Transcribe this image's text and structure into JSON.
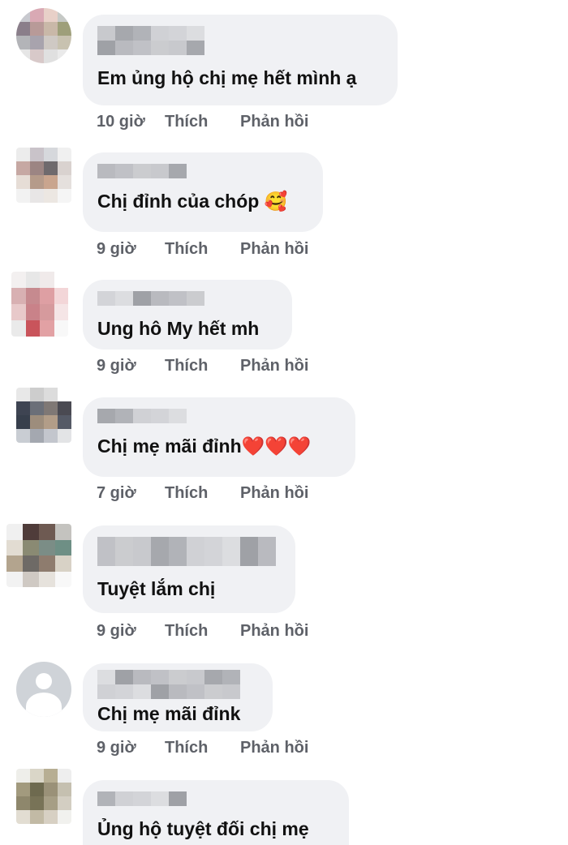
{
  "comments": [
    {
      "text": "Em ủng hộ chị mẹ hết mình ạ",
      "time": "10 giờ",
      "like": "Thích",
      "reply": "Phản hồi",
      "avatar_colors": [
        "#c8c9cf",
        "#d9a9b4",
        "#e8d0c8",
        "#c6c9c6",
        "#8a7e8a",
        "#b89a98",
        "#c9b8a8",
        "#9e9f7a",
        "#b3b4b8",
        "#a8a3ad",
        "#cfc9c4",
        "#c8c2b0",
        "#e6e6e6",
        "#d8c9c9",
        "#e0e0e0",
        "#eaeaea"
      ],
      "emoji": ""
    },
    {
      "text": "Chị đỉnh của chóp ",
      "time": "9 giờ",
      "like": "Thích",
      "reply": "Phản hồi",
      "avatar_colors": [
        "#ececec",
        "#c9c3c9",
        "#d6d8dc",
        "#f0f0f0",
        "#c6a8a3",
        "#9c8583",
        "#6f6a6d",
        "#d9d2cf",
        "#e6ddd6",
        "#b59b8a",
        "#c9a58e",
        "#e5e0dd",
        "#f2f2f2",
        "#e8e6e6",
        "#ece7e2",
        "#f5f5f5"
      ],
      "emoji": "🥰"
    },
    {
      "text": "Ung hô My hết mh",
      "time": "9 giờ",
      "like": "Thích",
      "reply": "Phản hồi",
      "avatar_colors": [
        "#f3f0f0",
        "#e7e7e7",
        "#f0eaea",
        "#ffffff",
        "#d8b0b2",
        "#c68a8f",
        "#de9fa3",
        "#f3d6d8",
        "#e8c9ca",
        "#c98289",
        "#d69a9d",
        "#f5e5e6",
        "#eaeaea",
        "#c9545b",
        "#e2a1a4",
        "#f8f8f8"
      ],
      "emoji": ""
    },
    {
      "text": "Chị mẹ mãi đỉnh",
      "time": "7 giờ",
      "like": "Thích",
      "reply": "Phản hồi",
      "avatar_colors": [
        "#e8e8e8",
        "#cdcdcd",
        "#dcdcdc",
        "#ffffff",
        "#3e4452",
        "#6b6f78",
        "#7f7875",
        "#4a4a52",
        "#373f4c",
        "#9d8d7c",
        "#b29d88",
        "#555a66",
        "#c9cdd3",
        "#a4a8b0",
        "#c3c6cd",
        "#e3e4e6"
      ],
      "emoji": "❤️❤️❤️"
    },
    {
      "text": "Tuyệt lắm chị",
      "time": "9 giờ",
      "like": "Thích",
      "reply": "Phản hồi",
      "avatar_colors": [
        "#f0f0f0",
        "#4f3c3a",
        "#6e5a52",
        "#c4c3bf",
        "#e2dcd2",
        "#8a8a73",
        "#7b8d86",
        "#6e8f85",
        "#b3a48e",
        "#6e6a66",
        "#8e7c6e",
        "#d8d2c6",
        "#f2f2f2",
        "#cfc9c3",
        "#e6e2dc",
        "#f8f8f8"
      ],
      "emoji": ""
    },
    {
      "text": "Chị mẹ mãi đỉnk",
      "time": "9 giờ",
      "like": "Thích",
      "reply": "Phản hồi",
      "avatar_colors": [],
      "emoji": ""
    },
    {
      "text": "Ủng hộ tuyệt đối chị mẹ",
      "time": "",
      "like": "",
      "reply": "",
      "avatar_colors": [
        "#eeeeea",
        "#dad6c8",
        "#b7ae93",
        "#eeeeee",
        "#a29a7e",
        "#6e6a4f",
        "#9a9178",
        "#c5c0b0",
        "#8e876c",
        "#787357",
        "#a69e85",
        "#d3cec2",
        "#e2ddd2",
        "#c2baa5",
        "#d7d0c3",
        "#f1f1ee"
      ],
      "emoji": ""
    }
  ],
  "name_blur_colors": [
    "#c8c9cd",
    "#b9babf",
    "#d3d4d8",
    "#a6a8ad",
    "#c0c1c6",
    "#dcdde0",
    "#b1b3b8",
    "#cbcccf",
    "#9fa1a6",
    "#d0d1d5"
  ]
}
